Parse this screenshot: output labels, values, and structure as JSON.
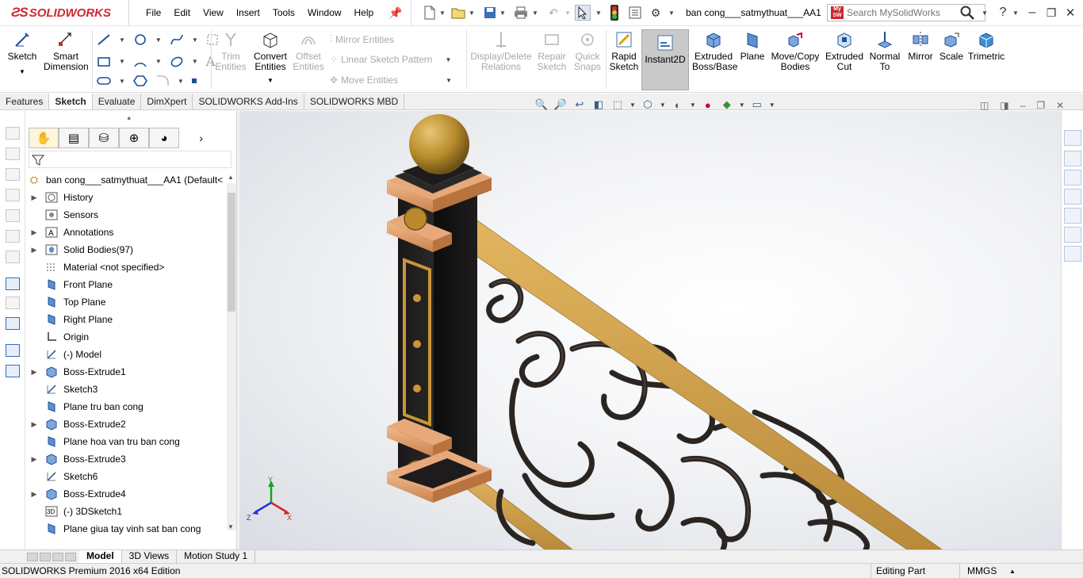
{
  "app": {
    "brand": "SOLIDWORKS",
    "doc_title": "ban cong___satmythuat___AA1"
  },
  "menu": [
    "File",
    "Edit",
    "View",
    "Insert",
    "Tools",
    "Window",
    "Help"
  ],
  "search": {
    "placeholder": "Search MySolidWorks",
    "badge": "My SW"
  },
  "commands": {
    "sketch": "Sketch",
    "smart_dimension": "Smart Dimension",
    "trim": "Trim Entities",
    "convert": "Convert Entities",
    "offset": "Offset Entities",
    "mirror_entities": "Mirror Entities",
    "linear_pattern": "Linear Sketch Pattern",
    "move_entities": "Move Entities",
    "display_delete": "Display/Delete Relations",
    "repair": "Repair Sketch",
    "quick_snaps": "Quick Snaps",
    "rapid_sketch": "Rapid Sketch",
    "instant2d": "Instant2D",
    "extruded_boss": "Extruded Boss/Base",
    "plane": "Plane",
    "move_copy": "Move/Copy Bodies",
    "extruded_cut": "Extruded Cut",
    "normal_to": "Normal To",
    "mirror": "Mirror",
    "scale": "Scale",
    "trimetric": "Trimetric"
  },
  "cm_tabs": [
    "Features",
    "Sketch",
    "Evaluate",
    "DimXpert",
    "SOLIDWORKS Add-Ins",
    "SOLIDWORKS MBD"
  ],
  "tree": {
    "root": "ban cong___satmythuat___AA1  (Default<",
    "items": [
      {
        "label": "History",
        "arrow": "▶"
      },
      {
        "label": "Sensors",
        "arrow": ""
      },
      {
        "label": "Annotations",
        "arrow": "▶"
      },
      {
        "label": "Solid Bodies(97)",
        "arrow": "▶"
      },
      {
        "label": "Material <not specified>",
        "arrow": ""
      },
      {
        "label": "Front Plane",
        "arrow": ""
      },
      {
        "label": "Top Plane",
        "arrow": ""
      },
      {
        "label": "Right Plane",
        "arrow": ""
      },
      {
        "label": "Origin",
        "arrow": ""
      },
      {
        "label": "(-) Model",
        "arrow": ""
      },
      {
        "label": "Boss-Extrude1",
        "arrow": "▶"
      },
      {
        "label": "Sketch3",
        "arrow": ""
      },
      {
        "label": "Plane tru ban cong",
        "arrow": ""
      },
      {
        "label": "Boss-Extrude2",
        "arrow": "▶"
      },
      {
        "label": "Plane hoa van tru ban cong",
        "arrow": ""
      },
      {
        "label": "Boss-Extrude3",
        "arrow": "▶"
      },
      {
        "label": "Sketch6",
        "arrow": ""
      },
      {
        "label": "Boss-Extrude4",
        "arrow": "▶"
      },
      {
        "label": "(-) 3DSketch1",
        "arrow": ""
      },
      {
        "label": "Plane giua tay vinh sat ban cong",
        "arrow": ""
      }
    ]
  },
  "triad": {
    "x": "X",
    "y": "Y",
    "z": "Z"
  },
  "bottom_tabs": [
    "Model",
    "3D Views",
    "Motion Study 1"
  ],
  "status": {
    "edition": "SOLIDWORKS Premium 2016 x64 Edition",
    "mode": "Editing Part",
    "units": "MMGS"
  }
}
